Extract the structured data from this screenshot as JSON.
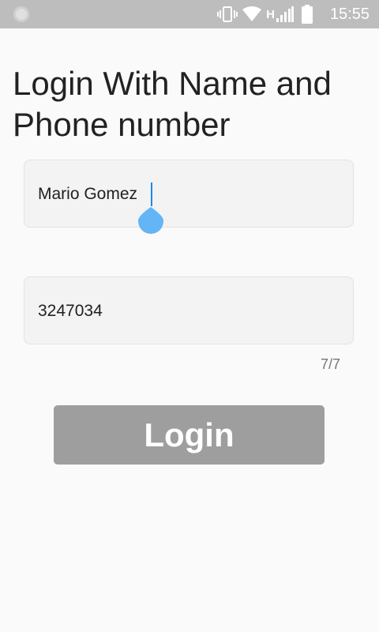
{
  "status_bar": {
    "time": "15:55",
    "network_type": "H",
    "icons": [
      "notification-icon",
      "vibrate-icon",
      "wifi-icon",
      "signal-icon",
      "battery-icon"
    ],
    "background_color": "#bdbdbd"
  },
  "page": {
    "title": "Login With Name and Phone number"
  },
  "form": {
    "name_value": "Mario Gomez",
    "phone_value": "3247034",
    "phone_counter": "7/7",
    "login_label": "Login",
    "cursor_color": "#1e88e5",
    "handle_color": "#64b5f6"
  }
}
